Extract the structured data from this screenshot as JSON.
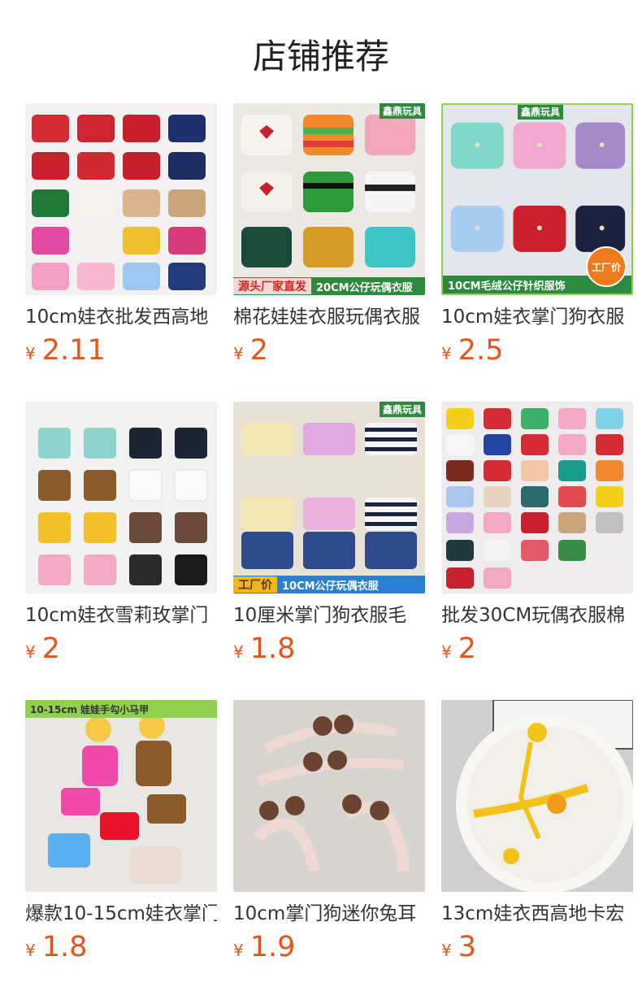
{
  "header": {
    "title": "店铺推荐"
  },
  "currency": "¥",
  "products": [
    {
      "name": "10cm娃衣批发西高地",
      "price": "2.11",
      "overlay": {}
    },
    {
      "name": "棉花娃娃衣服玩偶衣服",
      "price": "2",
      "overlay": {
        "shop_badge": "鑫鼎玩具",
        "banner_tag": "源头厂家直发",
        "banner_text": "20CM公仔玩偶衣服"
      }
    },
    {
      "name": "10cm娃衣掌门狗衣服",
      "price": "2.5",
      "overlay": {
        "shop_badge": "鑫鼎玩具",
        "banner_text": "10CM毛绒公仔针织服饰",
        "stamp": "工厂价"
      }
    },
    {
      "name": "10cm娃衣雪莉玫掌门",
      "price": "2",
      "overlay": {}
    },
    {
      "name": "10厘米掌门狗衣服毛",
      "price": "1.8",
      "overlay": {
        "shop_badge": "鑫鼎玩具",
        "banner_tag": "工厂价",
        "banner_text": "10CM公仔玩偶衣服"
      }
    },
    {
      "name": "批发30CM玩偶衣服棉",
      "price": "2",
      "overlay": {}
    },
    {
      "name": "爆款10-15cm娃衣掌门",
      "price": "1.8",
      "overlay": {
        "top_text": "10-15cm 娃娃手勾小马甲"
      }
    },
    {
      "name": "10cm掌门狗迷你兔耳",
      "price": "1.9",
      "overlay": {}
    },
    {
      "name": "13cm娃衣西高地卡宏",
      "price": "3",
      "overlay": {}
    }
  ]
}
